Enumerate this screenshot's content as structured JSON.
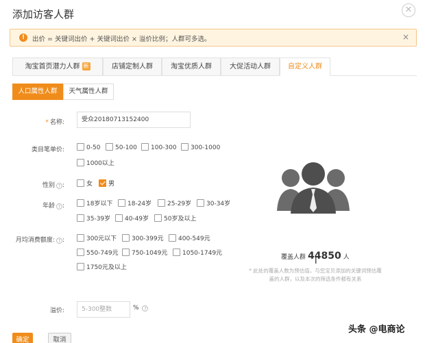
{
  "dialog": {
    "title": "添加访客人群",
    "close_icon": "close-icon"
  },
  "notice": {
    "icon": "warning-icon",
    "text": "出价 = 关键词出价 + 关键词出价 × 溢价比例；人群可多选。",
    "dismiss": "×"
  },
  "tabs": [
    {
      "label": "淘宝首页潜力人群",
      "badge": "新"
    },
    {
      "label": "店铺定制人群"
    },
    {
      "label": "淘宝优质人群"
    },
    {
      "label": "大促活动人群"
    },
    {
      "label": "自定义人群",
      "active": true
    }
  ],
  "subtabs": [
    {
      "label": "人口属性人群",
      "active": true
    },
    {
      "label": "天气属性人群"
    }
  ],
  "form": {
    "name": {
      "label": "名称:",
      "value": "受众20180713152400"
    },
    "price": {
      "label": "类目笔单价:",
      "options": [
        "0-50",
        "50-100",
        "100-300",
        "300-1000",
        "1000以上"
      ]
    },
    "gender": {
      "label": "性别",
      "options": [
        "女",
        "男"
      ],
      "checked": "男"
    },
    "age": {
      "label": "年龄",
      "options": [
        "18岁以下",
        "18-24岁",
        "25-29岁",
        "30-34岁",
        "35-39岁",
        "40-49岁",
        "50岁及以上"
      ]
    },
    "spend": {
      "label": "月均消费额度:",
      "options": [
        "300元以下",
        "300-399元",
        "400-549元",
        "550-749元",
        "750-1049元",
        "1050-1749元",
        "1750元及以上"
      ]
    },
    "premium": {
      "label": "溢价:",
      "placeholder": "5-300整数",
      "unit": "%"
    }
  },
  "coverage": {
    "prefix": "覆盖人群",
    "count": "44850",
    "suffix": "人"
  },
  "note": "* 此处的覆盖人数为预估值，与您宝贝添加的关键词预估覆盖的人群，以及本次的筛选条件都有关系",
  "buttons": {
    "confirm": "确定",
    "cancel": "取消"
  },
  "watermark": "头条 @电商论",
  "colors": {
    "accent": "#f08c1b",
    "notice_bg": "#fff4e0"
  }
}
